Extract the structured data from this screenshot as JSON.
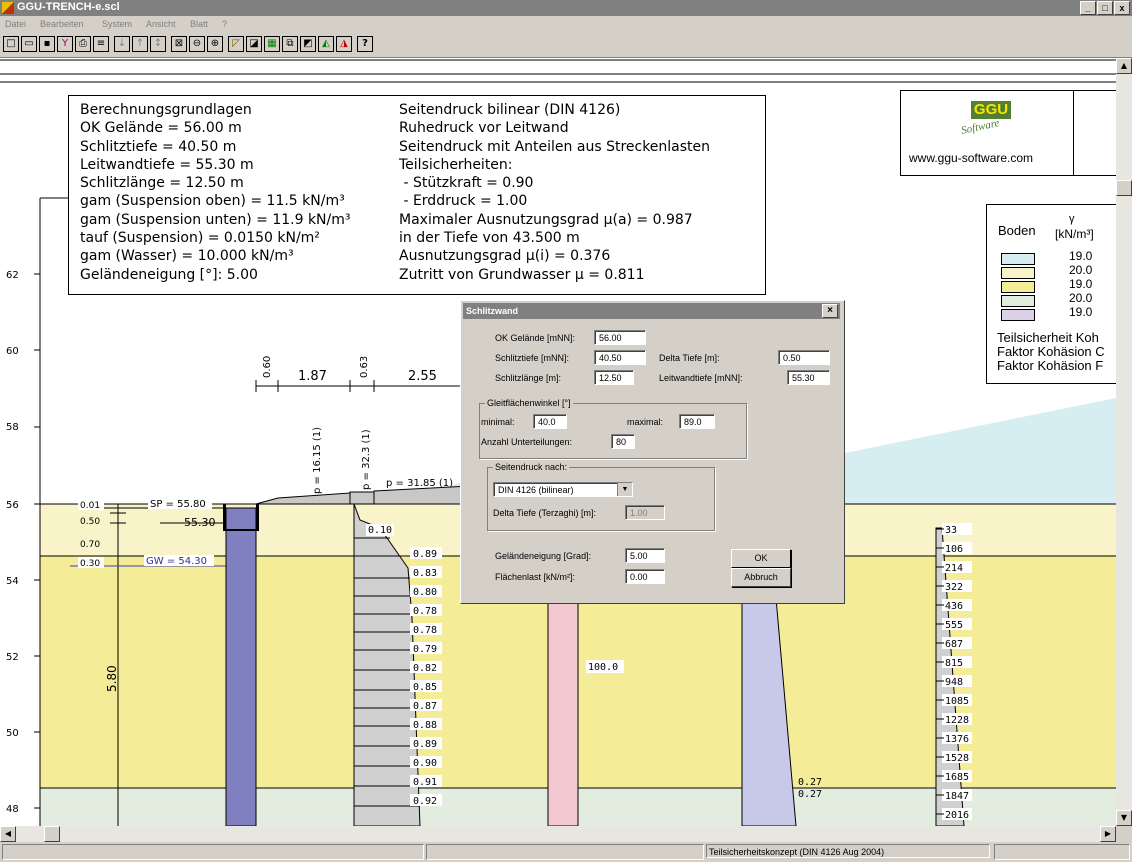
{
  "window": {
    "title": "GGU-TRENCH-e.scl",
    "buttons": [
      "_",
      "□",
      "x"
    ]
  },
  "menu": [
    "Datei",
    "Bearbeiten",
    "System",
    "Ansicht",
    "Blatt",
    "?"
  ],
  "toolbar_last": "?",
  "info": {
    "left": [
      "Berechnungsgrundlagen",
      "OK Gelände = 56.00 m",
      "Schlitztiefe = 40.50 m",
      "Leitwandtiefe = 55.30 m",
      "Schlitzlänge = 12.50 m",
      "gam (Suspension oben) = 11.5 kN/m³",
      "gam (Suspension unten) = 11.9 kN/m³",
      "tauf (Suspension) = 0.0150 kN/m²",
      "gam (Wasser) = 10.000 kN/m³",
      "Geländeneigung [°]: 5.00"
    ],
    "right": [
      "Seitendruck bilinear (DIN 4126)",
      "Ruhedruck vor Leitwand",
      "Seitendruck mit Anteilen aus Streckenlasten",
      "Teilsicherheiten:",
      " - Stützkraft = 0.90",
      " - Erddruck = 1.00",
      "Maximaler Ausnutzungsgrad µ(a) = 0.987",
      "in der Tiefe von 43.500 m",
      "Ausnutzungsgrad µ(i) = 0.376",
      "Zutritt von Grundwasser µ = 0.811"
    ]
  },
  "logo": {
    "text": "GGU",
    "sub": "Software",
    "url": "www.ggu-software.com"
  },
  "legend": {
    "title": "Boden",
    "unit_symbol": "γ",
    "unit": "[kN/m³]",
    "rows": [
      {
        "color": "#d6eef2",
        "value": "19.0"
      },
      {
        "color": "#f8f3c8",
        "value": "20.0"
      },
      {
        "color": "#f4ec96",
        "value": "19.0"
      },
      {
        "color": "#e2ede0",
        "value": "20.0"
      },
      {
        "color": "#dcd0e6",
        "value": "19.0"
      }
    ],
    "notes": [
      "Teilsicherheit Koh",
      "Faktor Kohäsion C",
      "Faktor Kohäsion F"
    ]
  },
  "drawing": {
    "y_axis": [
      "62",
      "60",
      "58",
      "56",
      "54",
      "52",
      "50",
      "48"
    ],
    "dims": [
      "0.60",
      "1.87",
      "0.63",
      "2.55"
    ],
    "loads": [
      "p = 16.15 (1)",
      "p = 32.3 (1)",
      "p = 31.85 (1)"
    ],
    "left_labels": [
      "0.01",
      "0.50",
      "0.70",
      "0.30"
    ],
    "sp": "SP = 55.80",
    "lw": "55.30",
    "gw": "GW = 54.30",
    "depth": "5.80",
    "mu_values": [
      "0.89",
      "0.83",
      "0.80",
      "0.78",
      "0.78",
      "0.79",
      "0.82",
      "0.85",
      "0.87",
      "0.88",
      "0.89",
      "0.90",
      "0.91",
      "0.92"
    ],
    "mu_top": "0.10",
    "center_value": "100.0",
    "pressure_values": [
      "33",
      "106",
      "214",
      "322",
      "436",
      "555",
      "687",
      "815",
      "948",
      "1085",
      "1228",
      "1376",
      "1528",
      "1685",
      "1847",
      "2016"
    ],
    "purple_values": [
      "0.27",
      "0.27"
    ]
  },
  "dialog": {
    "title": "Schlitzwand",
    "ok_gelaende_label": "OK Gelände [mNN]:",
    "ok_gelaende": "56.00",
    "schlitztiefe_label": "Schlitztiefe [mNN]:",
    "schlitztiefe": "40.50",
    "delta_tiefe_label": "Delta Tiefe [m]:",
    "delta_tiefe": "0.50",
    "schlitzlaenge_label": "Schlitzlänge [m]:",
    "schlitzlaenge": "12.50",
    "leitwandtiefe_label": "Leitwandtiefe [mNN]:",
    "leitwandtiefe": "55.30",
    "gleit_group": "Gleitflächenwinkel [°]",
    "minimal_label": "minimal:",
    "minimal": "40.0",
    "maximal_label": "maximal:",
    "maximal": "89.0",
    "anzahl_label": "Anzahl Unterteilungen:",
    "anzahl": "80",
    "seiten_group": "Seitendruck nach:",
    "seiten_select": "DIN 4126 (bilinear)",
    "terzaghi_label": "Delta Tiefe (Terzaghi) [m]:",
    "terzaghi": "1.00",
    "neigung_label": "Geländeneigung [Grad]:",
    "neigung": "5.00",
    "flaechenlast_label": "Flächenlast [kN/m²]:",
    "flaechenlast": "0.00",
    "ok_button": "OK",
    "cancel_button": "Abbruch"
  },
  "status": {
    "text": "Teilsicherheitskonzept (DIN 4126 Aug 2004)"
  }
}
